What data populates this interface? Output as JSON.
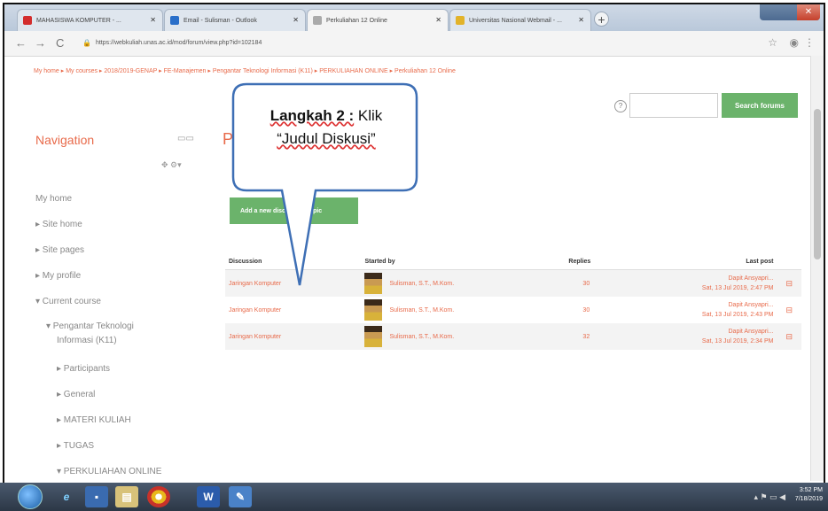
{
  "browser": {
    "tabs": [
      {
        "label": "MAHASISWA KOMPUTER - ..."
      },
      {
        "label": "Email - Sulisman - Outlook"
      },
      {
        "label": "Perkuliahan 12 Online"
      },
      {
        "label": "Universitas Nasional Webmail - ..."
      }
    ],
    "url": "https://webkuliah.unas.ac.id/mod/forum/view.php?id=102184"
  },
  "breadcrumb": "My home ▸ My courses ▸ 2018/2019-GENAP ▸ FE-Manajemen ▸ Pengantar Teknologi Informasi (K11) ▸ PERKULIAHAN ONLINE ▸ Perkuliahan 12 Online",
  "search": {
    "button_label": "Search forums",
    "placeholder": ""
  },
  "sidebar": {
    "title": "Navigation",
    "items": [
      {
        "label": "My home"
      },
      {
        "label": "▸ Site home"
      },
      {
        "label": "▸ Site pages"
      },
      {
        "label": "▸ My profile"
      },
      {
        "label": "▾ Current course"
      },
      {
        "label": "▾ Pengantar Teknologi"
      },
      {
        "label": "Informasi (K11)"
      },
      {
        "label": "▸ Participants"
      },
      {
        "label": "▸ General"
      },
      {
        "label": "▸ MATERI KULIAH"
      },
      {
        "label": "▸ TUGAS"
      },
      {
        "label": "▾ PERKULIAHAN ONLINE"
      }
    ]
  },
  "main": {
    "title": "P",
    "add_button": "Add a new discussion topic"
  },
  "table": {
    "headers": {
      "discussion": "Discussion",
      "started_by": "Started by",
      "replies": "Replies",
      "last_post": "Last post"
    },
    "rows": [
      {
        "discussion": "Jaringan Komputer",
        "started_by": "Sulisman, S.T., M.Kom.",
        "replies": "30",
        "last_name": "Dapit Ansyapri...",
        "last_date": "Sat, 13 Jul 2019, 2:47 PM"
      },
      {
        "discussion": "Jaringan Komputer",
        "started_by": "Sulisman, S.T., M.Kom.",
        "replies": "30",
        "last_name": "Dapit Ansyapri...",
        "last_date": "Sat, 13 Jul 2019, 2:43 PM"
      },
      {
        "discussion": "Jaringan Komputer",
        "started_by": "Sulisman, S.T., M.Kom.",
        "replies": "32",
        "last_name": "Dapit Ansyapri...",
        "last_date": "Sat, 13 Jul 2019, 2:34 PM"
      }
    ]
  },
  "callout": {
    "step": "Langkah 2 :",
    "action": " Klik",
    "target": "“Judul Diskusi”"
  },
  "taskbar": {
    "time": "3:52 PM",
    "date": "7/18/2019"
  },
  "colors": {
    "accent": "#e86a4a",
    "button": "#6bb36b",
    "callout_border": "#3e6fb5"
  }
}
